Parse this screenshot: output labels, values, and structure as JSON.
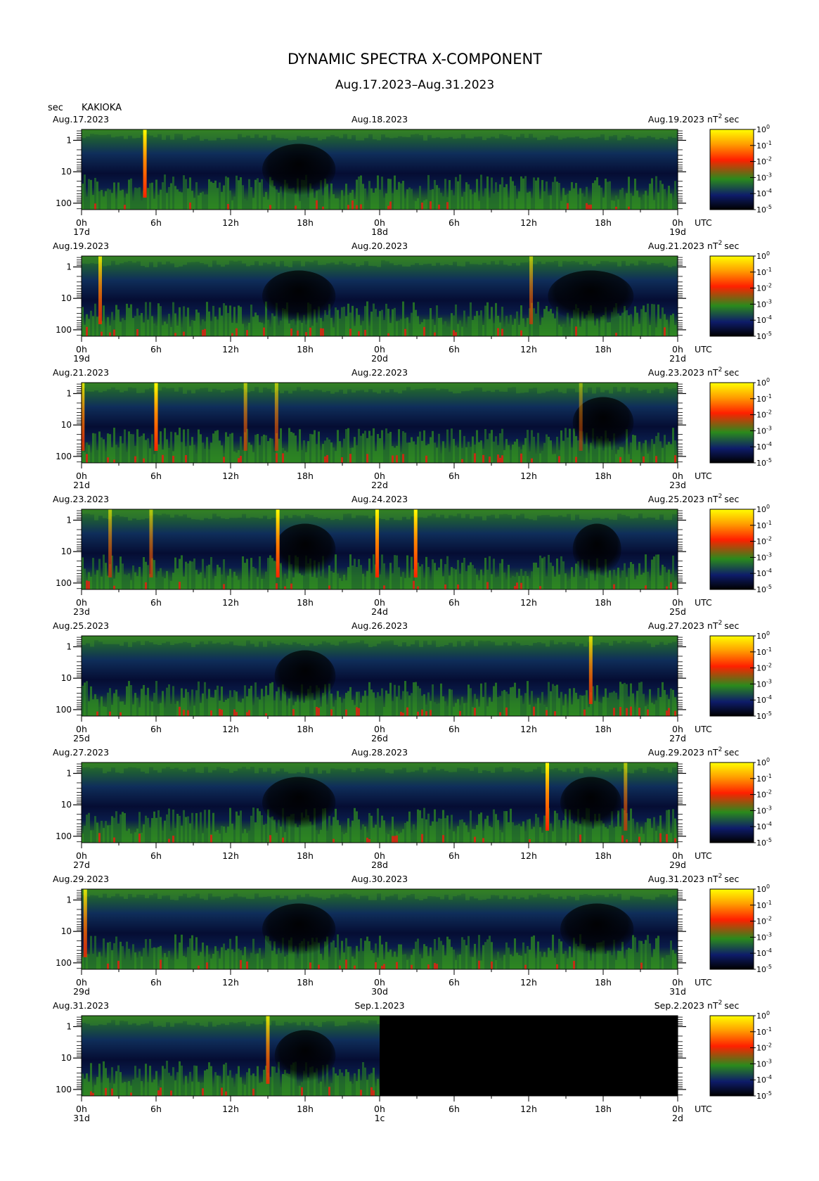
{
  "chart_data": {
    "type": "heatmap",
    "title": "DYNAMIC SPECTRA X-COMPONENT",
    "subtitle": "Aug.17.2023–Aug.31.2023",
    "station": "KAKIOKA",
    "y_unit": "sec",
    "time_unit": "UTC",
    "colorbar_unit": "nT²sec",
    "colorbar_unit_parts": [
      "nT",
      "2",
      "sec"
    ],
    "period_ticks": [
      "1",
      "10",
      "100"
    ],
    "hour_ticks": [
      "0h",
      "6h",
      "12h",
      "18h",
      "0h",
      "6h",
      "12h",
      "18h",
      "0h"
    ],
    "colorbar_ticks": [
      {
        "base": "10",
        "exp": "0"
      },
      {
        "base": "10",
        "exp": "-1"
      },
      {
        "base": "10",
        "exp": "-2"
      },
      {
        "base": "10",
        "exp": "-3"
      },
      {
        "base": "10",
        "exp": "-4"
      },
      {
        "base": "10",
        "exp": "-5"
      }
    ],
    "colorbar_colors": [
      "#ffff00",
      "#ffa000",
      "#ff2000",
      "#2a8a1c",
      "#0e1c6a",
      "#000000"
    ],
    "panels": [
      {
        "left_date": "Aug.17.2023",
        "mid_date": "Aug.18.2023",
        "right_date": "Aug.19.2023",
        "day_labels": [
          "17d",
          "18d",
          "19d"
        ],
        "events": [
          {
            "hour": 5.1,
            "level": "1e0"
          }
        ],
        "quiet_regions": [
          [
            15,
            20
          ]
        ],
        "data_end_hour": 48
      },
      {
        "left_date": "Aug.19.2023",
        "mid_date": "Aug.20.2023",
        "right_date": "Aug.21.2023",
        "day_labels": [
          "19d",
          "20d",
          "21d"
        ],
        "events": [
          {
            "hour": 1.5,
            "level": "1e-1"
          },
          {
            "hour": 36.2,
            "level": "1e-2"
          }
        ],
        "quiet_regions": [
          [
            15,
            20
          ],
          [
            38,
            44
          ]
        ],
        "data_end_hour": 48
      },
      {
        "left_date": "Aug.21.2023",
        "mid_date": "Aug.22.2023",
        "right_date": "Aug.23.2023",
        "day_labels": [
          "21d",
          "22d",
          "23d"
        ],
        "events": [
          {
            "hour": 0.1,
            "level": "1e-1"
          },
          {
            "hour": 6.0,
            "level": "1e0"
          },
          {
            "hour": 13.2,
            "level": "1e-2"
          },
          {
            "hour": 15.7,
            "level": "1e-2"
          },
          {
            "hour": 40.2,
            "level": "1e-3"
          }
        ],
        "quiet_regions": [
          [
            40,
            44
          ]
        ],
        "data_end_hour": 48
      },
      {
        "left_date": "Aug.23.2023",
        "mid_date": "Aug.24.2023",
        "right_date": "Aug.25.2023",
        "day_labels": [
          "23d",
          "24d",
          "25d"
        ],
        "events": [
          {
            "hour": 2.3,
            "level": "1e-2"
          },
          {
            "hour": 5.6,
            "level": "1e-2"
          },
          {
            "hour": 15.8,
            "level": "1e0"
          },
          {
            "hour": 23.8,
            "level": "1e0"
          },
          {
            "hour": 26.9,
            "level": "1e0"
          }
        ],
        "quiet_regions": [
          [
            16,
            20
          ],
          [
            40,
            43
          ]
        ],
        "data_end_hour": 48
      },
      {
        "left_date": "Aug.25.2023",
        "mid_date": "Aug.26.2023",
        "right_date": "Aug.27.2023",
        "day_labels": [
          "25d",
          "26d",
          "27d"
        ],
        "events": [
          {
            "hour": 41.0,
            "level": "1e-1"
          }
        ],
        "quiet_regions": [
          [
            16,
            20
          ]
        ],
        "data_end_hour": 48
      },
      {
        "left_date": "Aug.27.2023",
        "mid_date": "Aug.28.2023",
        "right_date": "Aug.29.2023",
        "day_labels": [
          "27d",
          "28d",
          "29d"
        ],
        "events": [
          {
            "hour": 37.5,
            "level": "1e0"
          },
          {
            "hour": 43.8,
            "level": "1e-2"
          }
        ],
        "quiet_regions": [
          [
            15,
            20
          ],
          [
            39,
            43
          ]
        ],
        "data_end_hour": 48
      },
      {
        "left_date": "Aug.29.2023",
        "mid_date": "Aug.30.2023",
        "right_date": "Aug.31.2023",
        "day_labels": [
          "29d",
          "30d",
          "31d"
        ],
        "events": [
          {
            "hour": 0.3,
            "level": "1e-1"
          }
        ],
        "quiet_regions": [
          [
            15,
            20
          ],
          [
            39,
            44
          ]
        ],
        "data_end_hour": 48
      },
      {
        "left_date": "Aug.31.2023",
        "mid_date": "Sep.1.2023",
        "right_date": "Sep.2.2023",
        "day_labels": [
          "31d",
          "1c",
          "2d"
        ],
        "events": [
          {
            "hour": 15.0,
            "level": "1e-1"
          }
        ],
        "quiet_regions": [
          [
            16,
            20
          ]
        ],
        "data_end_hour": 24
      }
    ]
  }
}
